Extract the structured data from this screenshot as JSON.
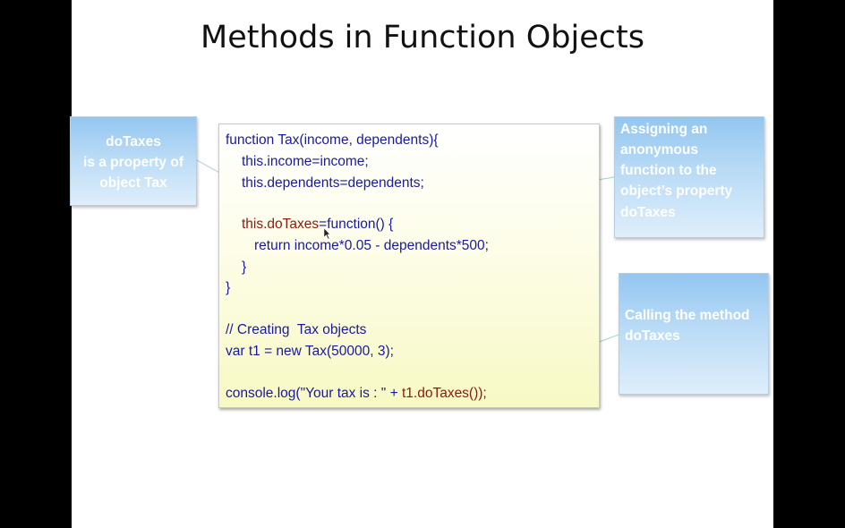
{
  "slide": {
    "title": "Methods in Function Objects"
  },
  "code": {
    "lines": [
      "function Tax(income, dependents){",
      "this.income=income;",
      "this.dependents=dependents;",
      "",
      "this.doTaxes",
      "=function() {",
      "return income*0.05 - dependents*500;",
      "}",
      "}",
      "",
      "// Creating  Tax objects",
      "var t1 = new Tax(50000, 3);",
      "",
      "console.log(\"Your tax is : \" + ",
      "t1.doTaxes());"
    ]
  },
  "callouts": {
    "left": [
      "doTaxes",
      "is a property of",
      "object Tax"
    ],
    "right_top": [
      "Assigning an",
      "anonymous",
      "function to the",
      "object’s property",
      "doTaxes"
    ],
    "right_bottom": [
      "Calling the method",
      "doTaxes"
    ]
  },
  "colors": {
    "code_blue": "#1a1a9c",
    "code_red": "#8a1a10",
    "callout_blue": "#93c6f0",
    "frame": "#000000"
  }
}
